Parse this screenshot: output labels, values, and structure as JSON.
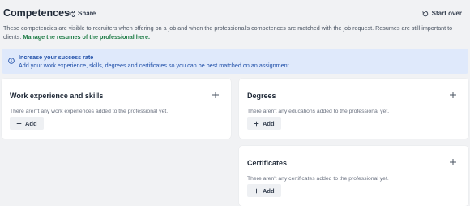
{
  "header": {
    "title": "Competences",
    "share_label": "Share",
    "start_over_label": "Start over"
  },
  "description": {
    "text": "These competencies are visible to recruiters when offering on a job and when the professional's competences are matched with the job request. Resumes are still important to clients.",
    "link_text": "Manage the resumes of the professional here."
  },
  "banner": {
    "title": "Increase your success rate",
    "text": "Add your work experience, skills, degrees and certificates so you can be best matched on an assignment."
  },
  "cards": {
    "work": {
      "title": "Work experience and skills",
      "empty_text": "There aren't any work experiences added to the professional yet.",
      "add_label": "Add"
    },
    "degrees": {
      "title": "Degrees",
      "empty_text": "There aren't any educations added to the professional yet.",
      "add_label": "Add"
    },
    "certificates": {
      "title": "Certificates",
      "empty_text": "There aren't any certificates added to the professional yet.",
      "add_label": "Add"
    }
  },
  "icons": {
    "share": "share-icon",
    "start_over": "refresh-icon",
    "info": "info-icon",
    "plus": "plus-icon"
  },
  "colors": {
    "background": "#f1f2f4",
    "banner_bg": "#dfe9fb",
    "banner_text": "#1e4ea8",
    "link": "#1b7a43"
  }
}
